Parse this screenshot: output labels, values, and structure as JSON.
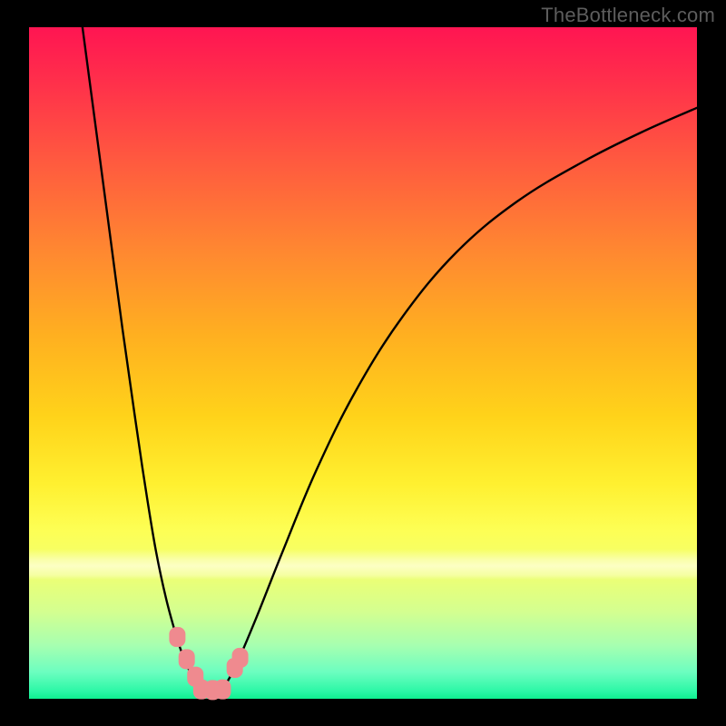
{
  "watermark": "TheBottleneck.com",
  "colors": {
    "background": "#000000",
    "watermark_text": "#5d5d5d",
    "curve_stroke": "#000000",
    "marker_fill": "#ef8a8f",
    "gradient_top": "#ff1552",
    "gradient_bottom": "#0ef08f"
  },
  "chart_data": {
    "type": "line",
    "title": "",
    "xlabel": "",
    "ylabel": "",
    "xlim": [
      0,
      100
    ],
    "ylim": [
      0,
      100
    ],
    "grid": false,
    "legend": false,
    "series": [
      {
        "name": "left-curve",
        "x": [
          8,
          10,
          12,
          14,
          16,
          17.5,
          19,
          20.5,
          22,
          23,
          24,
          25,
          25.8
        ],
        "values": [
          100,
          85,
          70,
          55,
          41,
          31,
          22,
          15,
          9.5,
          6.5,
          4.2,
          2.6,
          1.4
        ]
      },
      {
        "name": "right-curve",
        "x": [
          29,
          31,
          34,
          38,
          43,
          49,
          56,
          64,
          73,
          83,
          92,
          100
        ],
        "values": [
          1.4,
          5,
          12,
          22,
          34,
          46,
          57,
          66.5,
          74,
          80,
          84.5,
          88
        ]
      }
    ],
    "markers": [
      {
        "name": "marker-left-1",
        "x": 22.2,
        "y": 9.2
      },
      {
        "name": "marker-left-2",
        "x": 23.6,
        "y": 5.9
      },
      {
        "name": "marker-left-3",
        "x": 24.9,
        "y": 3.3
      },
      {
        "name": "marker-bottom-1",
        "x": 25.8,
        "y": 1.4
      },
      {
        "name": "marker-bottom-2",
        "x": 27.5,
        "y": 1.3
      },
      {
        "name": "marker-bottom-3",
        "x": 29.0,
        "y": 1.4
      },
      {
        "name": "marker-right-1",
        "x": 30.8,
        "y": 4.6
      },
      {
        "name": "marker-right-2",
        "x": 31.6,
        "y": 6.1
      }
    ],
    "annotations": []
  }
}
